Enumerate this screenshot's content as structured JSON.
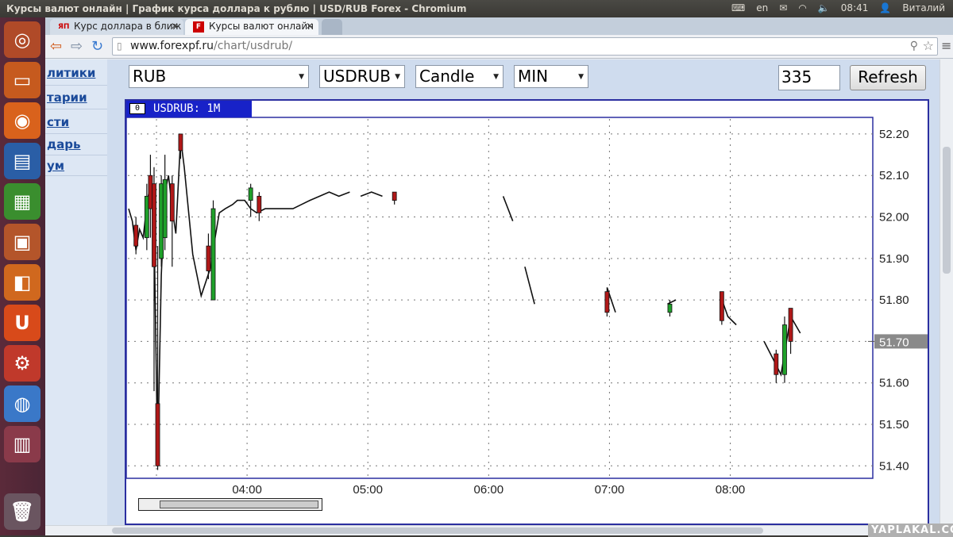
{
  "topbar": {
    "window_title": "Курсы валют онлайн | График курса доллара к рублю | USD/RUB Forex - Chromium",
    "lang": "en",
    "time": "08:41",
    "user": "Виталий"
  },
  "tabs": [
    {
      "favicon": "ЯП",
      "label": "Курс доллара в ближ"
    },
    {
      "favicon": "F",
      "label": "Курсы валют онлайн"
    }
  ],
  "omnibox": {
    "host": "www.forexpf.ru",
    "path": "/chart/usdrub/"
  },
  "leftnav": [
    "литики",
    "тарии",
    "сти",
    "дарь",
    "ум"
  ],
  "controls": {
    "currency": "RUB",
    "pair": "USDRUB",
    "chart_type": "Candle",
    "period": "MIN",
    "count": "335",
    "refresh_label": "Refresh"
  },
  "chart_header": {
    "box": "0",
    "label": "USDRUB: 1M"
  },
  "watermark": "YAPLAKAL.COM",
  "colors": {
    "up": "#1fa02a",
    "down": "#b01818",
    "frame": "#2b2fa0",
    "header": "#1822c8"
  },
  "chart_data": {
    "type": "candlestick",
    "symbol": "USDRUB",
    "interval": "1M",
    "yticks": [
      "52.20",
      "52.10",
      "52.00",
      "51.90",
      "51.80",
      "51.70",
      "51.60",
      "51.50",
      "51.40"
    ],
    "ylim": [
      51.37,
      52.24
    ],
    "xticks": [
      "04:00",
      "05:00",
      "06:00",
      "07:00",
      "08:00"
    ],
    "last_price": "51.70",
    "grid": true,
    "series": [
      {
        "t": 3.02,
        "v": 52.02
      },
      {
        "t": 3.05,
        "v": 51.99
      },
      {
        "t": 3.08,
        "v": 51.92
      },
      {
        "t": 3.11,
        "v": 51.97
      },
      {
        "t": 3.14,
        "v": 51.95
      },
      {
        "t": 3.17,
        "v": 52.03
      },
      {
        "t": 3.2,
        "v": 52.08
      },
      {
        "t": 3.23,
        "v": 51.97
      },
      {
        "t": 3.26,
        "v": 51.42
      },
      {
        "t": 3.29,
        "v": 51.86
      },
      {
        "t": 3.32,
        "v": 52.06
      },
      {
        "t": 3.35,
        "v": 52.1
      },
      {
        "t": 3.38,
        "v": 52.02
      },
      {
        "t": 3.41,
        "v": 51.96
      },
      {
        "t": 3.45,
        "v": 52.19
      },
      {
        "t": 3.48,
        "v": 52.12
      },
      {
        "t": 3.55,
        "v": 51.91
      },
      {
        "t": 3.62,
        "v": 51.81
      },
      {
        "t": 3.7,
        "v": 51.88
      },
      {
        "t": 3.73,
        "v": 51.94
      },
      {
        "t": 3.77,
        "v": 52.01
      },
      {
        "t": 3.82,
        "v": 52.02
      },
      {
        "t": 3.88,
        "v": 52.03
      },
      {
        "t": 3.92,
        "v": 52.04
      },
      {
        "t": 3.98,
        "v": 52.04
      },
      {
        "t": 4.03,
        "v": 52.02
      },
      {
        "t": 4.08,
        "v": 52.01
      },
      {
        "t": 4.15,
        "v": 52.02
      },
      {
        "t": 4.22,
        "v": 52.02
      },
      {
        "t": 4.3,
        "v": 52.02
      },
      {
        "t": 4.38,
        "v": 52.02
      },
      {
        "t": 4.45,
        "v": 52.03
      },
      {
        "t": 4.52,
        "v": 52.04
      },
      {
        "t": 4.6,
        "v": 52.05
      },
      {
        "t": 4.68,
        "v": 52.06
      },
      {
        "t": 4.76,
        "v": 52.05
      },
      {
        "t": 4.85,
        "v": 52.06
      },
      {
        "t": 4.94,
        "v": 52.05
      },
      {
        "t": 5.03,
        "v": 52.06
      },
      {
        "t": 5.12,
        "v": 52.05
      },
      {
        "t": 5.22,
        "v": 52.05
      },
      {
        "t": 5.32,
        "v": 52.05
      },
      {
        "t": 5.42,
        "v": 52.04
      },
      {
        "t": 5.52,
        "v": 52.04
      },
      {
        "t": 5.62,
        "v": 52.04
      },
      {
        "t": 5.72,
        "v": 52.04
      },
      {
        "t": 5.82,
        "v": 52.05
      },
      {
        "t": 5.92,
        "v": 52.04
      },
      {
        "t": 6.02,
        "v": 52.05
      },
      {
        "t": 6.12,
        "v": 52.05
      },
      {
        "t": 6.2,
        "v": 51.99
      },
      {
        "t": 6.3,
        "v": 51.88
      },
      {
        "t": 6.38,
        "v": 51.79
      },
      {
        "t": 6.5,
        "v": 51.8
      },
      {
        "t": 6.62,
        "v": 51.81
      },
      {
        "t": 6.75,
        "v": 51.82
      },
      {
        "t": 6.88,
        "v": 51.82
      },
      {
        "t": 6.98,
        "v": 51.83
      },
      {
        "t": 7.05,
        "v": 51.77
      },
      {
        "t": 7.15,
        "v": 51.77
      },
      {
        "t": 7.28,
        "v": 51.76
      },
      {
        "t": 7.38,
        "v": 51.77
      },
      {
        "t": 7.48,
        "v": 51.79
      },
      {
        "t": 7.55,
        "v": 51.8
      },
      {
        "t": 7.65,
        "v": 51.8
      },
      {
        "t": 7.78,
        "v": 51.8
      },
      {
        "t": 7.92,
        "v": 51.81
      },
      {
        "t": 7.98,
        "v": 51.76
      },
      {
        "t": 8.05,
        "v": 51.74
      },
      {
        "t": 8.15,
        "v": 51.72
      },
      {
        "t": 8.28,
        "v": 51.7
      },
      {
        "t": 8.35,
        "v": 51.66
      },
      {
        "t": 8.42,
        "v": 51.62
      },
      {
        "t": 8.5,
        "v": 51.76
      },
      {
        "t": 8.58,
        "v": 51.72
      },
      {
        "t": 8.68,
        "v": 51.7
      }
    ],
    "candles": [
      {
        "t": 3.08,
        "o": 51.98,
        "c": 51.93,
        "h": 52.0,
        "l": 51.91,
        "dir": "down"
      },
      {
        "t": 3.17,
        "o": 51.95,
        "c": 52.05,
        "h": 52.08,
        "l": 51.92,
        "dir": "up"
      },
      {
        "t": 3.2,
        "o": 52.1,
        "c": 52.02,
        "h": 52.15,
        "l": 51.95,
        "dir": "down"
      },
      {
        "t": 3.23,
        "o": 52.08,
        "c": 51.88,
        "h": 52.12,
        "l": 51.58,
        "dir": "down"
      },
      {
        "t": 3.26,
        "o": 51.55,
        "c": 51.4,
        "h": 51.93,
        "l": 51.39,
        "dir": "down"
      },
      {
        "t": 3.29,
        "o": 51.9,
        "c": 52.08,
        "h": 52.1,
        "l": 51.88,
        "dir": "up"
      },
      {
        "t": 3.32,
        "o": 51.95,
        "c": 52.09,
        "h": 52.15,
        "l": 51.92,
        "dir": "up"
      },
      {
        "t": 3.38,
        "o": 52.08,
        "c": 51.99,
        "h": 52.1,
        "l": 51.88,
        "dir": "down"
      },
      {
        "t": 3.45,
        "o": 52.2,
        "c": 52.16,
        "h": 52.2,
        "l": 52.14,
        "dir": "down"
      },
      {
        "t": 3.68,
        "o": 51.93,
        "c": 51.87,
        "h": 51.96,
        "l": 51.85,
        "dir": "down"
      },
      {
        "t": 3.72,
        "o": 51.8,
        "c": 52.02,
        "h": 52.04,
        "l": 51.8,
        "dir": "up"
      },
      {
        "t": 4.03,
        "o": 52.04,
        "c": 52.07,
        "h": 52.08,
        "l": 52.0,
        "dir": "up"
      },
      {
        "t": 4.1,
        "o": 52.05,
        "c": 52.01,
        "h": 52.06,
        "l": 51.99,
        "dir": "down"
      },
      {
        "t": 5.22,
        "o": 52.06,
        "c": 52.04,
        "h": 52.06,
        "l": 52.03,
        "dir": "down"
      },
      {
        "t": 6.98,
        "o": 51.82,
        "c": 51.77,
        "h": 51.83,
        "l": 51.76,
        "dir": "down"
      },
      {
        "t": 7.5,
        "o": 51.77,
        "c": 51.79,
        "h": 51.8,
        "l": 51.76,
        "dir": "up"
      },
      {
        "t": 7.93,
        "o": 51.82,
        "c": 51.75,
        "h": 51.82,
        "l": 51.74,
        "dir": "down"
      },
      {
        "t": 8.38,
        "o": 51.67,
        "c": 51.62,
        "h": 51.68,
        "l": 51.6,
        "dir": "down"
      },
      {
        "t": 8.45,
        "o": 51.62,
        "c": 51.74,
        "h": 51.76,
        "l": 51.6,
        "dir": "up"
      },
      {
        "t": 8.5,
        "o": 51.78,
        "c": 51.7,
        "h": 51.78,
        "l": 51.67,
        "dir": "down"
      }
    ]
  }
}
